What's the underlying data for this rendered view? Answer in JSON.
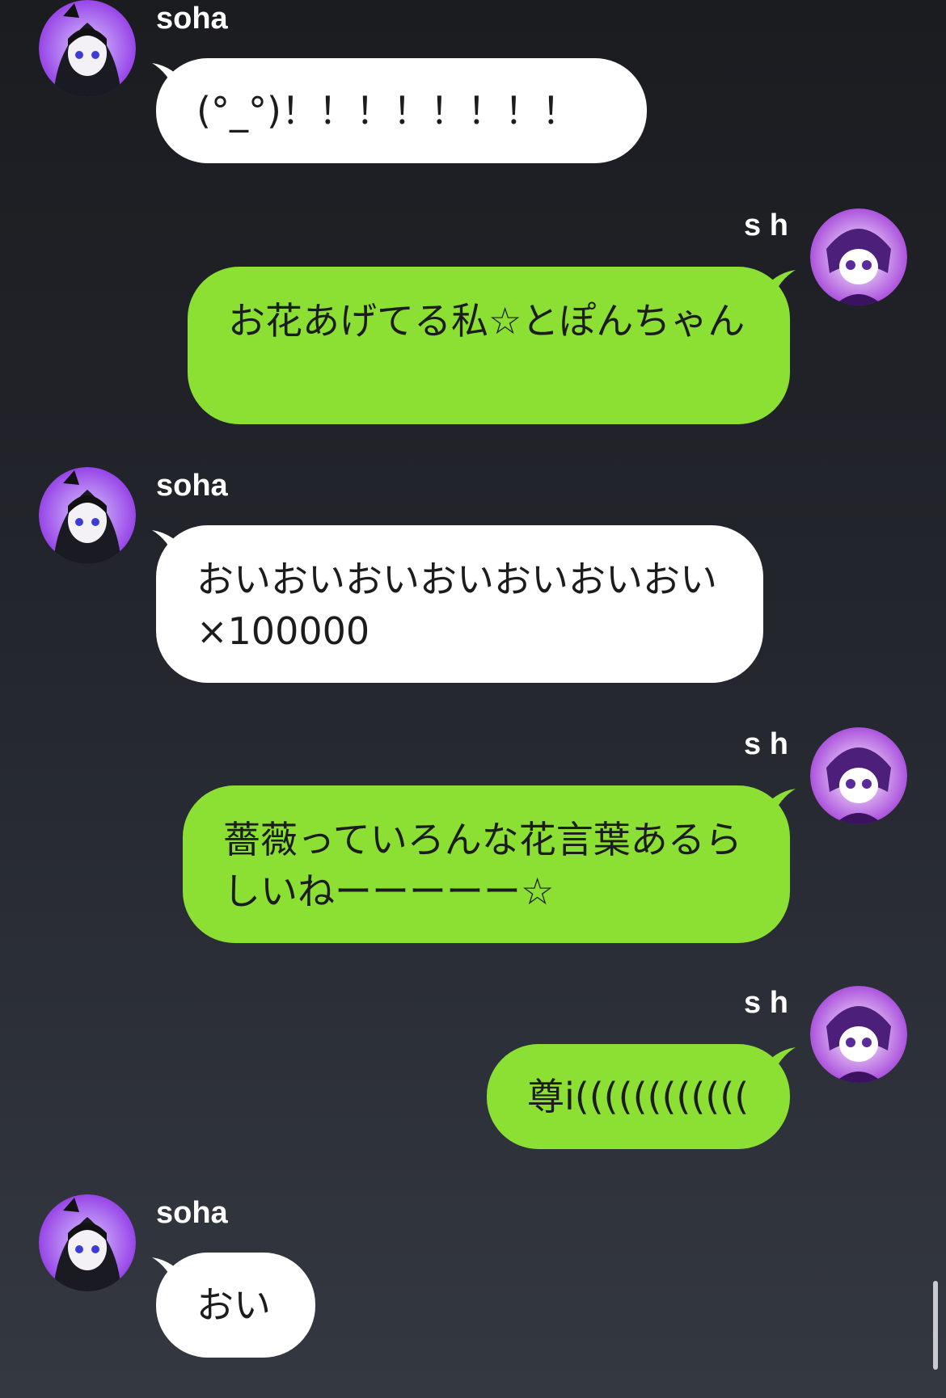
{
  "colors": {
    "incoming_bubble": "#ffffff",
    "outgoing_bubble": "#8ce033",
    "name_text": "#ffffff",
    "message_text": "#1c1c1c"
  },
  "messages": [
    {
      "sender": "soha",
      "side": "left",
      "avatar_icon": "soha-avatar-icon",
      "text": "(°_°)！！！！！！！！"
    },
    {
      "sender": "s h",
      "side": "right",
      "avatar_icon": "sh-avatar-icon",
      "text": "お花あげてる私☆とぽんちゃん"
    },
    {
      "sender": "soha",
      "side": "left",
      "avatar_icon": "soha-avatar-icon",
      "text": "おいおいおいおいおいおいおい×100000"
    },
    {
      "sender": "s h",
      "side": "right",
      "avatar_icon": "sh-avatar-icon",
      "text": "薔薇っていろんな花言葉あるらしいねーーーーー☆"
    },
    {
      "sender": "s h",
      "side": "right",
      "avatar_icon": "sh-avatar-icon",
      "text": "尊i(((((((((((("
    },
    {
      "sender": "soha",
      "side": "left",
      "avatar_icon": "soha-avatar-icon",
      "text": "おい"
    }
  ]
}
